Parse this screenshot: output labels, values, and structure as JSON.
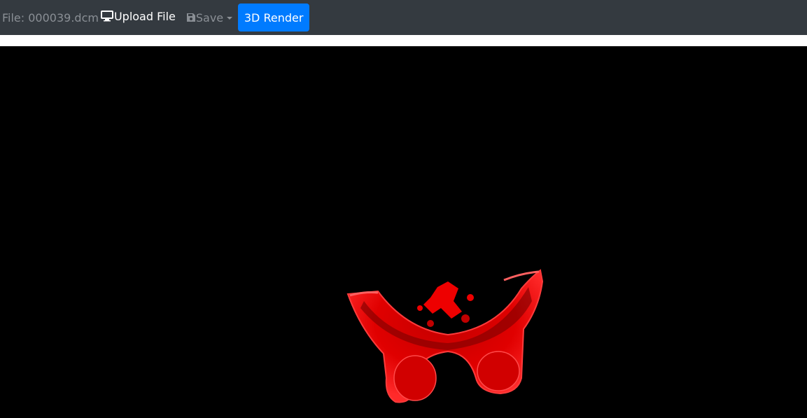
{
  "toolbar": {
    "file_label": "File: 000039.dcm",
    "upload_label": "Upload File",
    "save_label": "Save",
    "render_label": "3D Render"
  },
  "icons": {
    "upload": "monitor-icon",
    "save": "floppy-disk-icon",
    "save_dropdown": "caret-down-icon"
  },
  "colors": {
    "toolbar_bg": "#343a40",
    "primary_button": "#007bff",
    "render_model": "#ff0000",
    "viewport_bg": "#000000"
  }
}
